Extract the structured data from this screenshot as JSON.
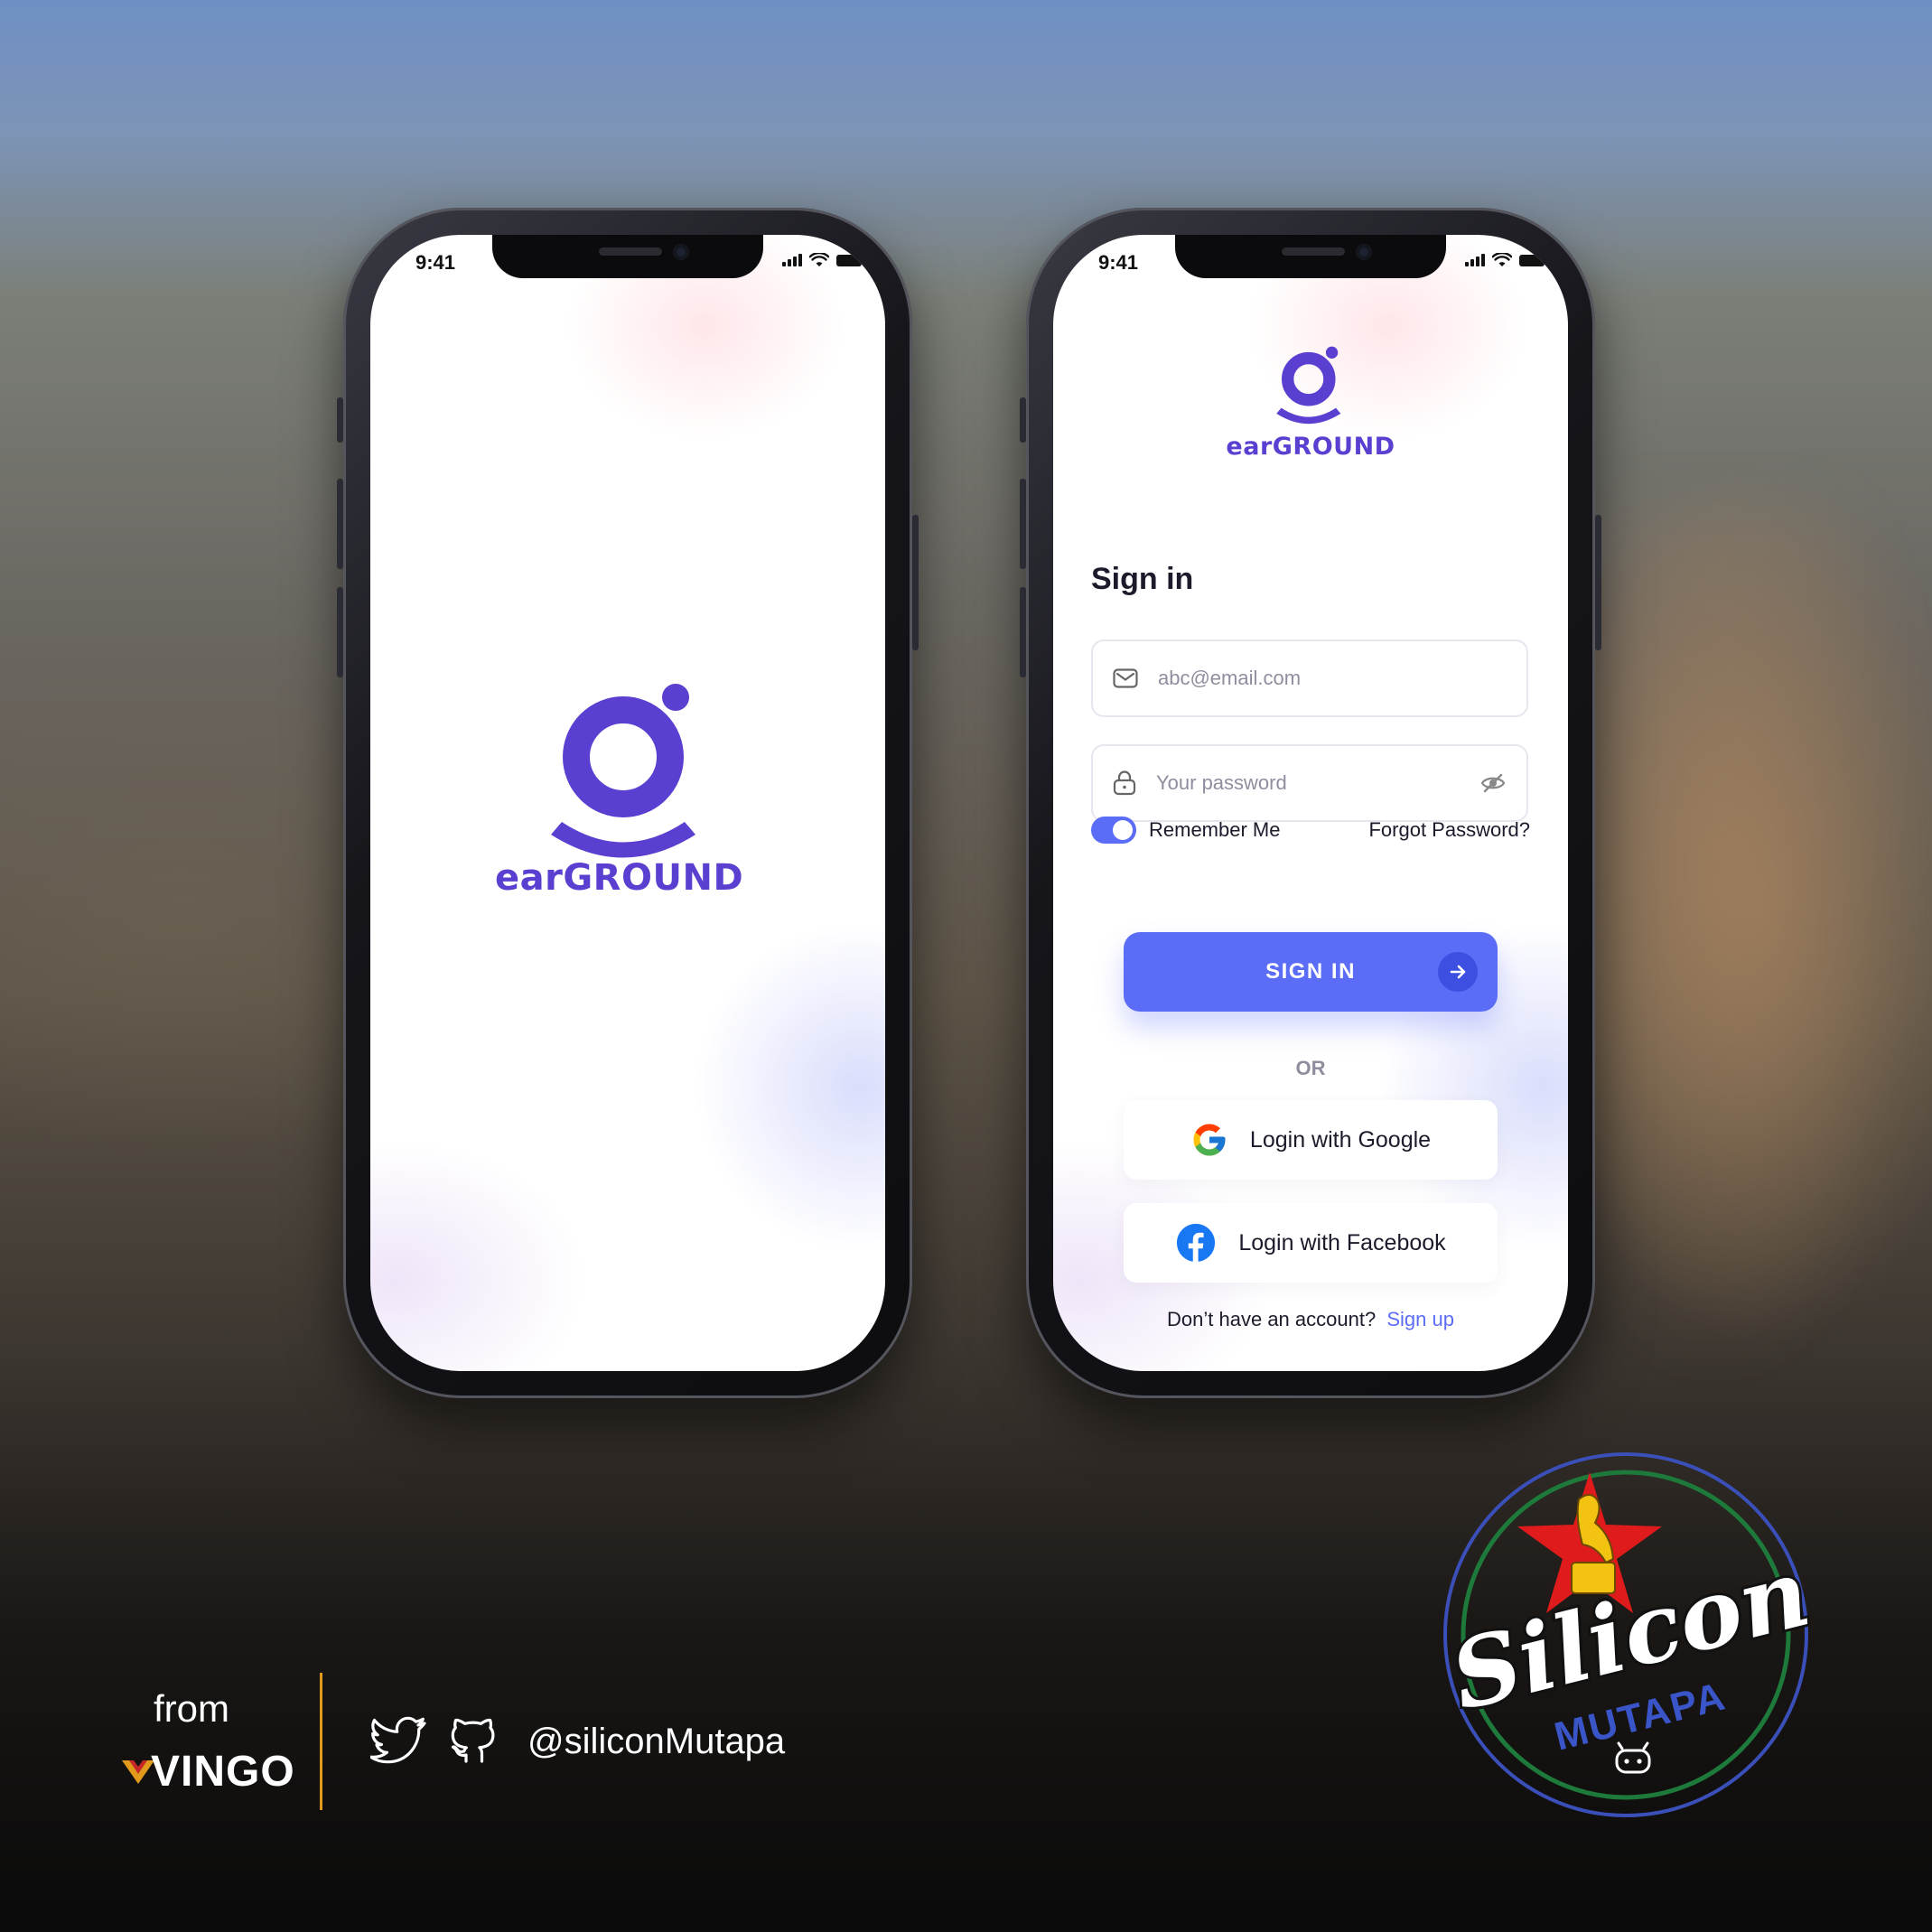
{
  "splash": {
    "status_time": "9:41",
    "logo_text": "earGROUND"
  },
  "signin": {
    "status_time": "9:41",
    "logo_text": "earGROUND",
    "title": "Sign in",
    "email_placeholder": "abc@email.com",
    "password_placeholder": "Your password",
    "remember_label": "Remember Me",
    "remember_on": true,
    "forgot_label": "Forgot Password?",
    "signin_button": "SIGN IN",
    "or_label": "OR",
    "google_button": "Login with Google",
    "facebook_button": "Login with Facebook",
    "no_account_text": "Don’t have an account?",
    "signup_link": "Sign up"
  },
  "footer": {
    "from_label": "from",
    "brand": "VINGO",
    "handle": "@siliconMutapa"
  },
  "badge": {
    "line1": "Silicon",
    "line2": "MUTAPA"
  },
  "colors": {
    "brand_purple": "#5b3fd1",
    "primary_button": "#5b6cf7",
    "divider_orange": "#e29a1d"
  }
}
